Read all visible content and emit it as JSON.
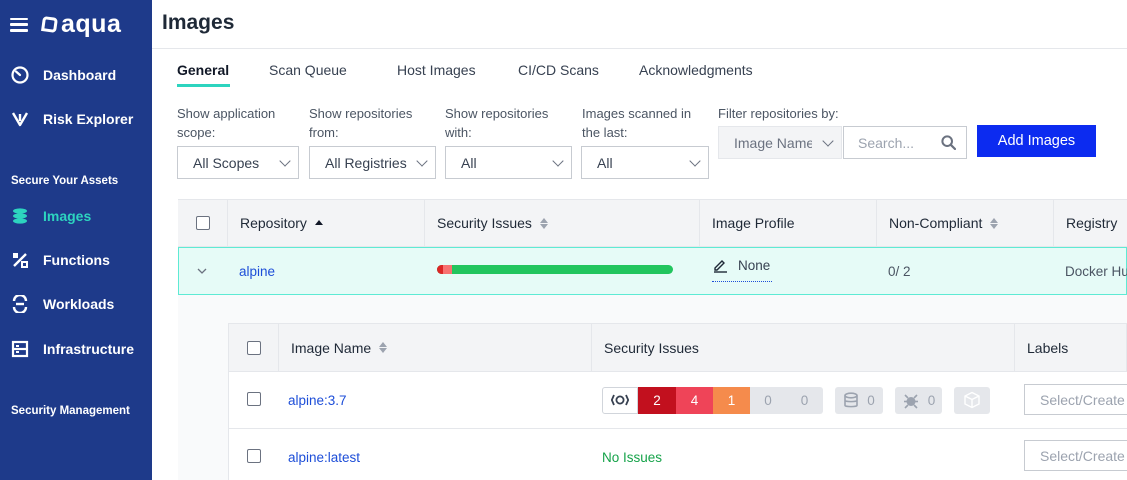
{
  "sidebar": {
    "logo": "aqua",
    "items": [
      {
        "label": "Dashboard"
      },
      {
        "label": "Risk Explorer"
      },
      {
        "label": "Images"
      },
      {
        "label": "Functions"
      },
      {
        "label": "Workloads"
      },
      {
        "label": "Infrastructure"
      }
    ],
    "sections": [
      "Secure Your Assets",
      "Security Management"
    ],
    "active_item": "Images",
    "accent_color": "#2dd4bf",
    "background_color": "#1e3a8a"
  },
  "page": {
    "title": "Images"
  },
  "tabs": [
    {
      "label": "General",
      "active": true
    },
    {
      "label": "Scan Queue"
    },
    {
      "label": "Host Images"
    },
    {
      "label": "CI/CD Scans"
    },
    {
      "label": "Acknowledgments"
    }
  ],
  "filters": {
    "scope_label": "Show application scope:",
    "scope_value": "All Scopes",
    "registries_label": "Show repositories from:",
    "registries_value": "All Registries",
    "with_label": "Show repositories with:",
    "with_value": "All",
    "scanned_label": "Images scanned in the last:",
    "scanned_value": "All",
    "filter_label": "Filter repositories by:",
    "filter_value": "Image Name",
    "search_placeholder": "Search...",
    "add_button": "Add Images"
  },
  "table": {
    "headers": [
      "Repository",
      "Security Issues",
      "Image Profile",
      "Non-Compliant",
      "Registry"
    ],
    "row": {
      "repository": "alpine",
      "issues_bar": {
        "critical_fraction": 0.025,
        "high_fraction": 0.04
      },
      "image_profile": "None",
      "non_compliant": "0/ 2",
      "registry": "Docker Hub"
    }
  },
  "subtable": {
    "headers": [
      "Image Name",
      "Security Issues",
      "Labels"
    ],
    "rows": [
      {
        "name": "alpine:3.7",
        "severity": {
          "critical": "2",
          "high": "4",
          "medium": "1",
          "low": "0",
          "negligible": "0"
        },
        "malware": "0",
        "sensitive": "0",
        "labels_placeholder": "Select/Create"
      },
      {
        "name": "alpine:latest",
        "status": "No Issues",
        "labels_placeholder": "Select/Create"
      }
    ],
    "colors": {
      "critical": "#c2101e",
      "high": "#ef4458",
      "medium": "#f58b4c",
      "ok": "#16a34a"
    }
  }
}
